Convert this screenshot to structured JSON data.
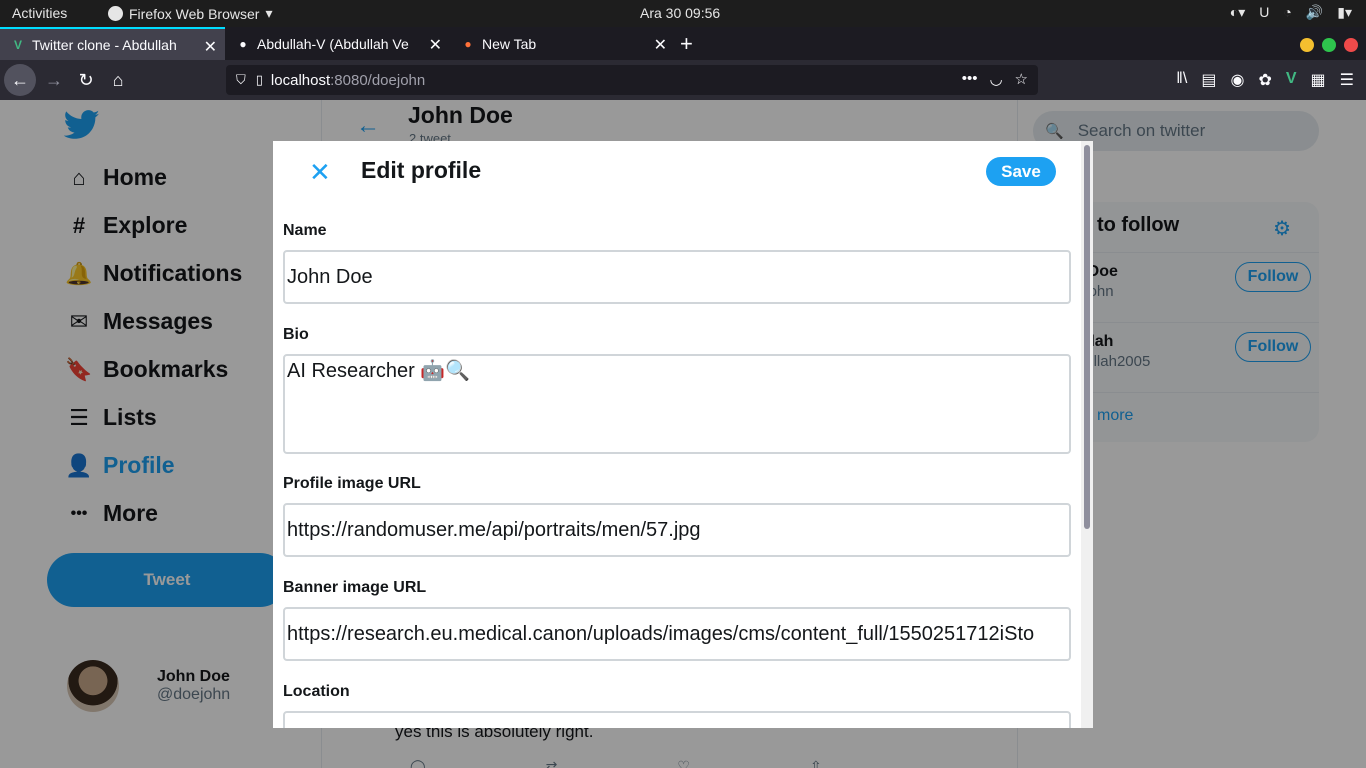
{
  "system": {
    "activities": "Activities",
    "app_menu": "Firefox Web Browser",
    "clock": "Ara 30  09:56"
  },
  "tabs": [
    {
      "title": "Twitter clone - Abdullah",
      "active": true
    },
    {
      "title": "Abdullah-V (Abdullah Ve",
      "active": false
    },
    {
      "title": "New Tab",
      "active": false
    }
  ],
  "url": {
    "host": "localhost",
    "rest": ":8080/doejohn"
  },
  "nav": {
    "items": [
      {
        "label": "Home",
        "icon": "home-icon",
        "glyph": "⌂"
      },
      {
        "label": "Explore",
        "icon": "hash-icon",
        "glyph": "#"
      },
      {
        "label": "Notifications",
        "icon": "bell-icon",
        "glyph": "🔔"
      },
      {
        "label": "Messages",
        "icon": "mail-icon",
        "glyph": "✉"
      },
      {
        "label": "Bookmarks",
        "icon": "bookmark-icon",
        "glyph": "🔖"
      },
      {
        "label": "Lists",
        "icon": "list-icon",
        "glyph": "☰"
      },
      {
        "label": "Profile",
        "icon": "user-icon",
        "glyph": "👤"
      },
      {
        "label": "More",
        "icon": "more-icon",
        "glyph": "•••"
      }
    ],
    "tweet_button": "Tweet"
  },
  "me": {
    "name": "John Doe",
    "handle": "@doejohn"
  },
  "profile_header": {
    "name": "John Doe",
    "count": "2 tweet"
  },
  "timeline": {
    "tweet_text": "yes this is absolutely right."
  },
  "right": {
    "search_placeholder": "Search on twitter",
    "who_to_follow": "to follow",
    "suggestions": [
      {
        "name": "John Doe",
        "handle": "@doejohn",
        "button": "Follow"
      },
      {
        "name": "Abdullah",
        "handle": "@abdullah2005",
        "button": "Follow"
      }
    ],
    "show_more": "more"
  },
  "modal": {
    "title": "Edit profile",
    "save": "Save",
    "fields": {
      "name": {
        "label": "Name",
        "value": "John Doe"
      },
      "bio": {
        "label": "Bio",
        "value": "AI Researcher 🤖🔍"
      },
      "profile_image": {
        "label": "Profile image URL",
        "value": "https://randomuser.me/api/portraits/men/57.jpg"
      },
      "banner_image": {
        "label": "Banner image URL",
        "value": "https://research.eu.medical.canon/uploads/images/cms/content_full/1550251712iSto"
      },
      "location": {
        "label": "Location",
        "value": ""
      }
    }
  },
  "colors": {
    "accent": "#1da1f2",
    "text": "#14171a",
    "muted": "#657786"
  }
}
